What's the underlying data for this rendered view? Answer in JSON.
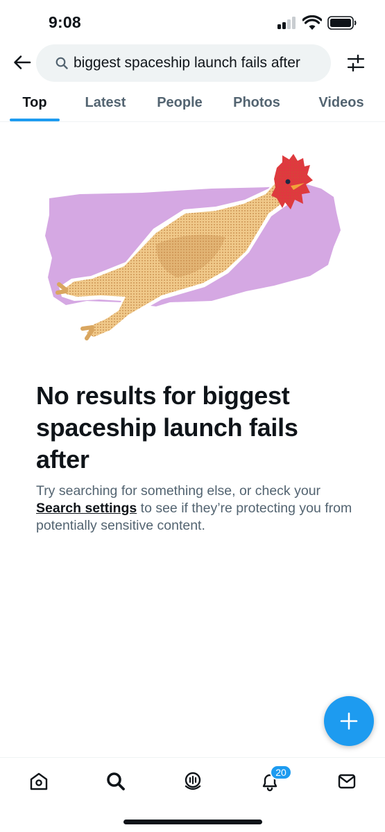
{
  "status_bar": {
    "time": "9:08"
  },
  "search": {
    "query": "biggest spaceship launch fails after",
    "back_icon": "arrow-left-icon",
    "filter_icon": "sliders-icon"
  },
  "tabs": [
    {
      "label": "Top",
      "active": true
    },
    {
      "label": "Latest",
      "active": false
    },
    {
      "label": "People",
      "active": false
    },
    {
      "label": "Photos",
      "active": false
    },
    {
      "label": "Videos",
      "active": false
    }
  ],
  "empty_state": {
    "title": "No results for biggest spaceship launch fails after",
    "body_before": "Try searching for something else, or check your ",
    "link": "Search settings",
    "body_after": " to see if they’re protecting you from potentially sensitive content."
  },
  "bottom_nav": {
    "items": [
      "home-icon",
      "search-icon",
      "spaces-icon",
      "notifications-icon",
      "messages-icon"
    ],
    "notification_count": "20"
  },
  "colors": {
    "accent": "#1d9bf0",
    "text_primary": "#0f1419",
    "text_secondary": "#536471",
    "illustration_bg": "#d5a8e3"
  }
}
